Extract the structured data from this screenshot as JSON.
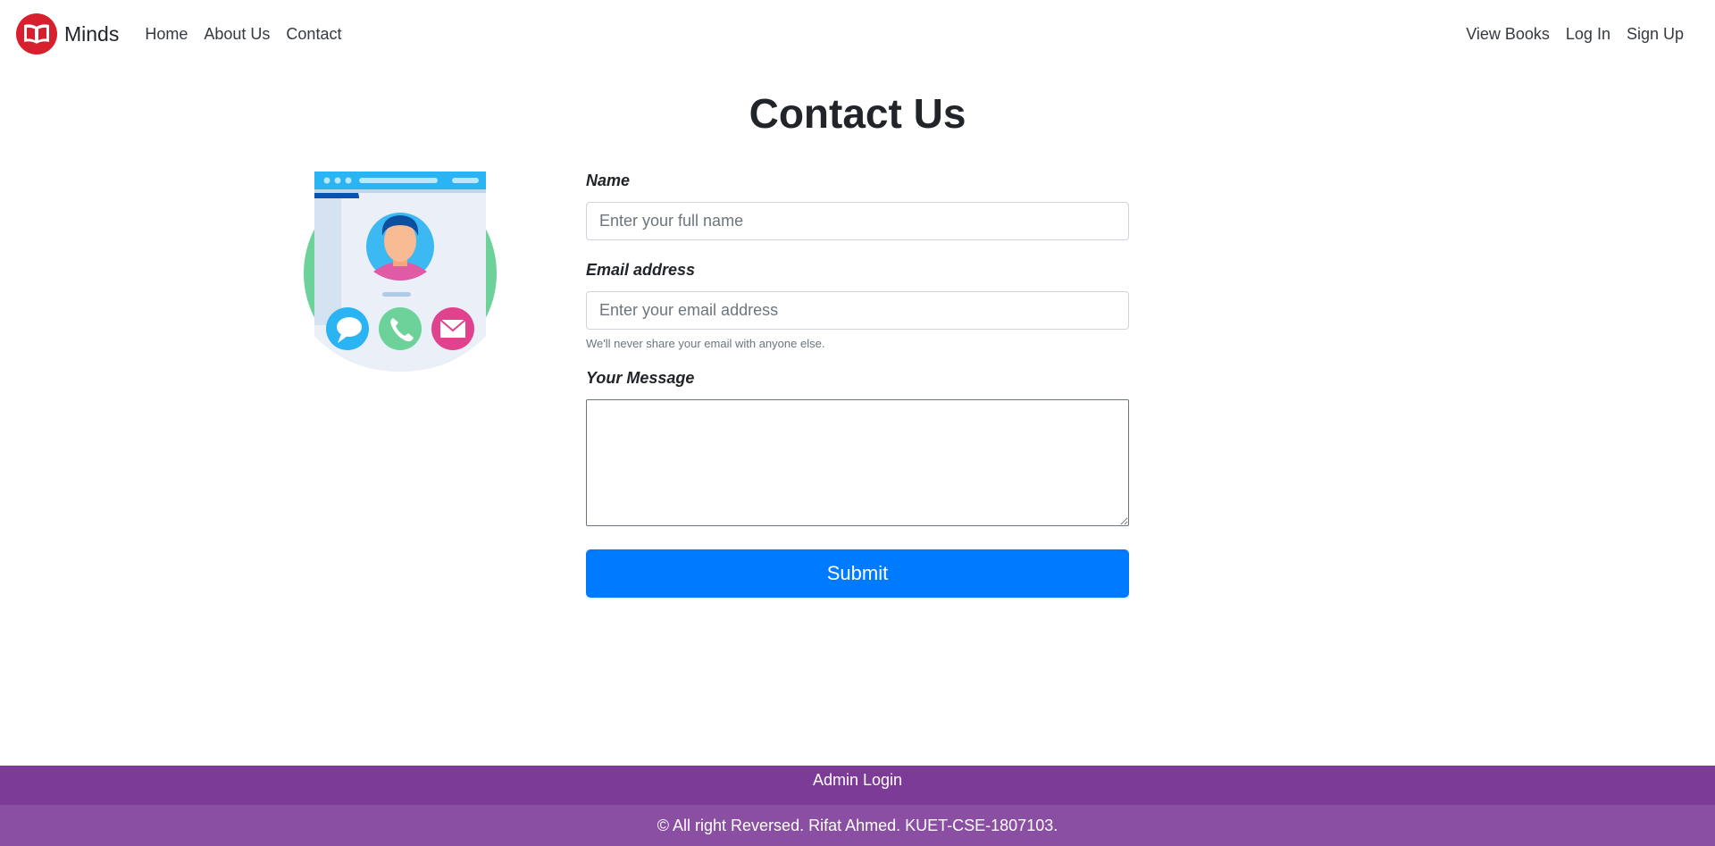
{
  "brand": {
    "name": "Minds",
    "logo_icon": "open-book-icon",
    "logo_color": "#d81f2e"
  },
  "nav": {
    "left": [
      "Home",
      "About Us",
      "Contact"
    ],
    "right": [
      "View Books",
      "Log In",
      "Sign Up"
    ]
  },
  "page": {
    "title": "Contact Us"
  },
  "illustration": {
    "icon": "contact-card-illustration"
  },
  "form": {
    "name_label": "Name",
    "name_placeholder": "Enter your full name",
    "name_value": "",
    "email_label": "Email address",
    "email_placeholder": "Enter your email address",
    "email_value": "",
    "email_help": "We'll never share your email with anyone else.",
    "message_label": "Your Message",
    "message_value": "",
    "submit_label": "Submit"
  },
  "footer": {
    "admin_link": "Admin Login",
    "copyright": "© All right Reversed. Rifat Ahmed. KUET-CSE-1807103."
  },
  "colors": {
    "primary": "#007bff",
    "footer_top": "#7b3b96",
    "footer_bottom": "#8a4ea3"
  }
}
